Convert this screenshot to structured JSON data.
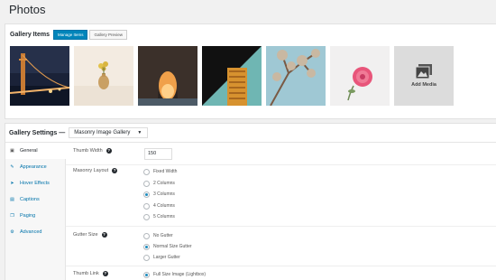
{
  "page": {
    "title": "Photos"
  },
  "gallery_items": {
    "title": "Gallery Items",
    "tabs": [
      {
        "label": "Manage Items",
        "active": true
      },
      {
        "label": "Gallery Preview",
        "active": false
      }
    ],
    "add_media_label": "Add Media"
  },
  "settings": {
    "title": "Gallery Settings",
    "separator": "—",
    "layout_select": "Masonry Image Gallery",
    "nav": [
      {
        "label": "General",
        "icon": "gallery-icon",
        "active": true
      },
      {
        "label": "Appearance",
        "icon": "brush-icon",
        "active": false
      },
      {
        "label": "Hover Effects",
        "icon": "pointer-icon",
        "active": false
      },
      {
        "label": "Captions",
        "icon": "caption-icon",
        "active": false
      },
      {
        "label": "Paging",
        "icon": "paging-icon",
        "active": false
      },
      {
        "label": "Advanced",
        "icon": "gear-icon",
        "active": false
      }
    ],
    "thumb_width": {
      "label": "Thumb Width",
      "value": "150"
    },
    "masonry_layout": {
      "label": "Masonry Layout",
      "options": [
        "Fixed Width",
        "2 Columns",
        "3 Columns",
        "4 Columns",
        "5 Columns"
      ],
      "selected": "3 Columns"
    },
    "gutter_size": {
      "label": "Gutter Size",
      "options": [
        "No Gutter",
        "Normal Size Gutter",
        "Larger Gutter"
      ],
      "selected": "Normal Size Gutter"
    },
    "thumb_link": {
      "label": "Thumb Link",
      "options": [
        "Full Size Image (Lightbox)"
      ],
      "selected": "Full Size Image (Lightbox)"
    }
  },
  "colors": {
    "accent": "#0085ba",
    "link": "#0073aa",
    "radio_selected": "#1e8cbe"
  }
}
